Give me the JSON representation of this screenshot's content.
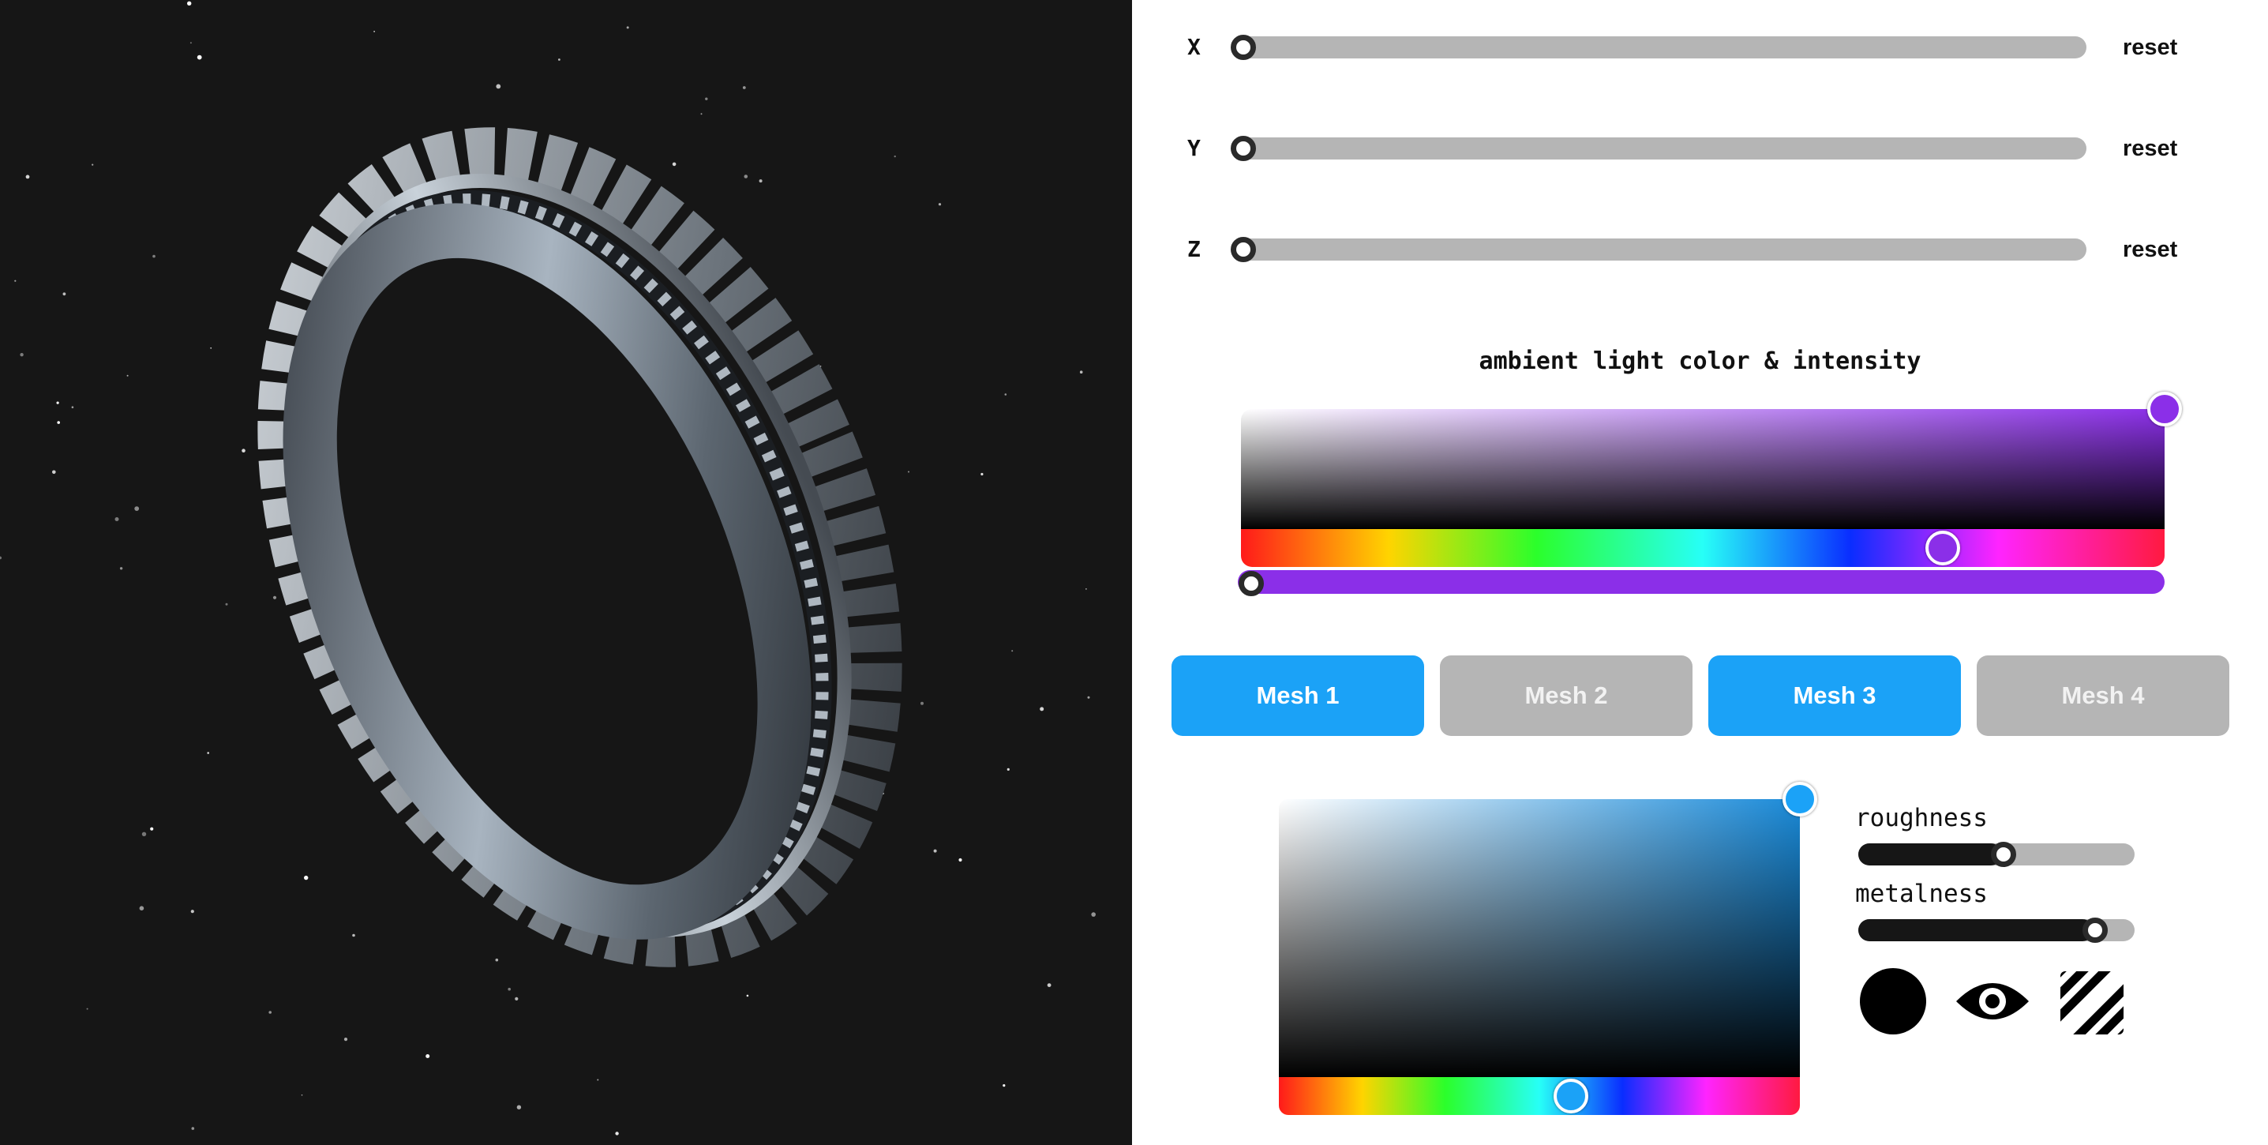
{
  "viewport": {
    "background": "#161616",
    "object": "ring-model"
  },
  "transform": {
    "axes": [
      {
        "label": "X",
        "value": 0,
        "reset_label": "reset"
      },
      {
        "label": "Y",
        "value": 0,
        "reset_label": "reset"
      },
      {
        "label": "Z",
        "value": 0,
        "reset_label": "reset"
      }
    ]
  },
  "ambient": {
    "title": "ambient light color & intensity",
    "color": "#8b2fe8",
    "hue_position": 0.76,
    "intensity": 0.0
  },
  "meshes": [
    {
      "label": "Mesh 1",
      "active": true
    },
    {
      "label": "Mesh 2",
      "active": false
    },
    {
      "label": "Mesh 3",
      "active": true
    },
    {
      "label": "Mesh 4",
      "active": false
    }
  ],
  "material": {
    "color": "#1ba2f7",
    "hue_position": 0.56,
    "roughness_label": "roughness",
    "roughness": 0.52,
    "metalness_label": "metalness",
    "metalness": 0.85,
    "icons": [
      "solid-circle-icon",
      "eye-icon",
      "stripes-icon"
    ]
  },
  "colors": {
    "accent": "#1ba2f7",
    "inactive": "#b5b5b5",
    "ambient": "#8b2fe8"
  }
}
